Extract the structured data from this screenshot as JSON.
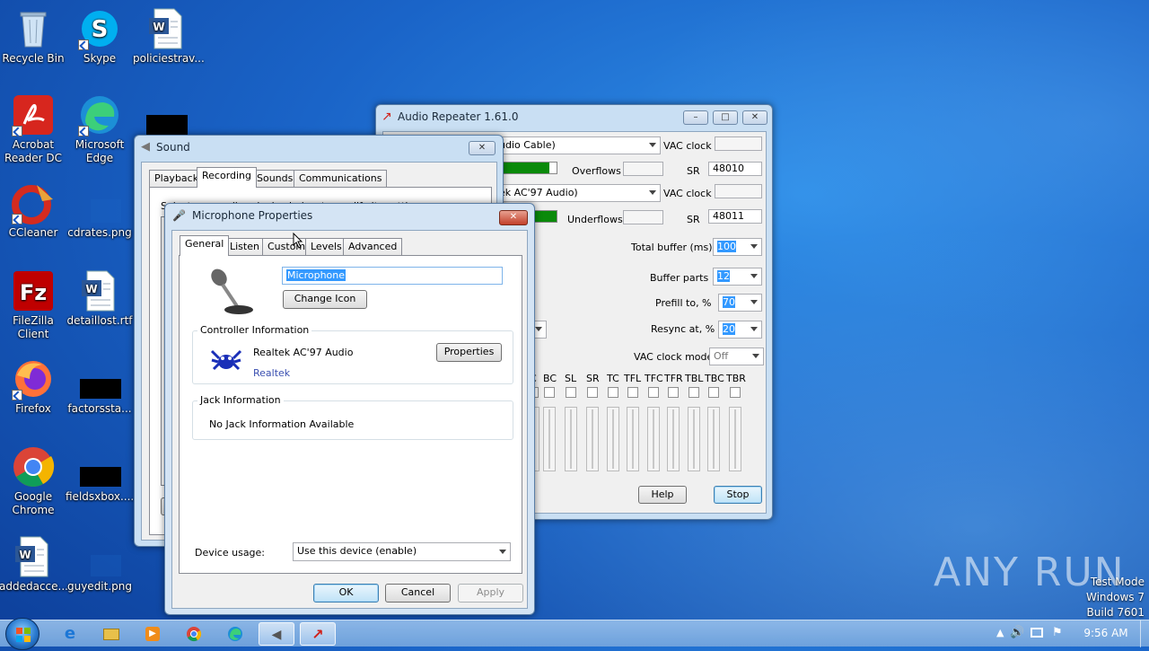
{
  "desktop": {
    "icons": [
      {
        "label": "Recycle Bin"
      },
      {
        "label": "Skype"
      },
      {
        "label": "policiestrav..."
      },
      {
        "label": "Acrobat Reader DC"
      },
      {
        "label": "Microsoft Edge"
      },
      {
        "label": "CCleaner"
      },
      {
        "label": "cdrates.png"
      },
      {
        "label": "FileZilla Client"
      },
      {
        "label": "detaillost.rtf"
      },
      {
        "label": "Firefox"
      },
      {
        "label": "factorssta..."
      },
      {
        "label": "Google Chrome"
      },
      {
        "label": "fieldsxbox...."
      },
      {
        "label": "addedacce..."
      },
      {
        "label": "guyedit.png"
      }
    ],
    "watermark": "ANY RUN",
    "test_mode": [
      "Test Mode",
      "Windows 7",
      "Build 7601"
    ]
  },
  "audio_repeater": {
    "title": "Audio Repeater 1.61.0",
    "input_device": "udio Cable)",
    "output_device": "ek AC'97 Audio)",
    "vac_clock_label": "VAC clock",
    "overflows_label": "Overflows",
    "underflows_label": "Underflows",
    "sr_label": "SR",
    "sr_in": "48010",
    "sr_out": "48011",
    "total_buffer_label": "Total buffer (ms)",
    "total_buffer_value": "100",
    "buffer_parts_label": "Buffer parts",
    "buffer_parts_value": "12",
    "prefill_label": "Prefill to, %",
    "prefill_value": "70",
    "resync_label": "Resync at, %",
    "resync_value": "20",
    "vac_clock_mode_label": "VAC clock mode",
    "vac_clock_mode_value": "Off",
    "channels": [
      "C",
      "BC",
      "SL",
      "SR",
      "TC",
      "TFL",
      "TFC",
      "TFR",
      "TBL",
      "TBC",
      "TBR"
    ],
    "help_label": "Help",
    "stop_label": "Stop"
  },
  "sound": {
    "title": "Sound",
    "tabs": [
      "Playback",
      "Recording",
      "Sounds",
      "Communications"
    ],
    "active_tab": "Recording",
    "hint_text": "Select a recording device below to modify its settings:"
  },
  "mic_props": {
    "title": "Microphone Properties",
    "tabs": [
      "General",
      "Listen",
      "Custom",
      "Levels",
      "Advanced"
    ],
    "active_tab": "General",
    "name_value": "Microphone",
    "change_icon_label": "Change Icon",
    "controller_title": "Controller Information",
    "controller_name": "Realtek AC'97 Audio",
    "controller_vendor": "Realtek",
    "properties_label": "Properties",
    "jack_title": "Jack Information",
    "jack_text": "No Jack Information Available",
    "device_usage_label": "Device usage:",
    "device_usage_value": "Use this device (enable)",
    "ok_label": "OK",
    "cancel_label": "Cancel",
    "apply_label": "Apply"
  },
  "taskbar": {
    "clock": "9:56 AM"
  },
  "colors": {
    "meter_green": "#0a8a0a",
    "selection_blue": "#3399ff",
    "vendor_link": "#3a4fb0"
  }
}
